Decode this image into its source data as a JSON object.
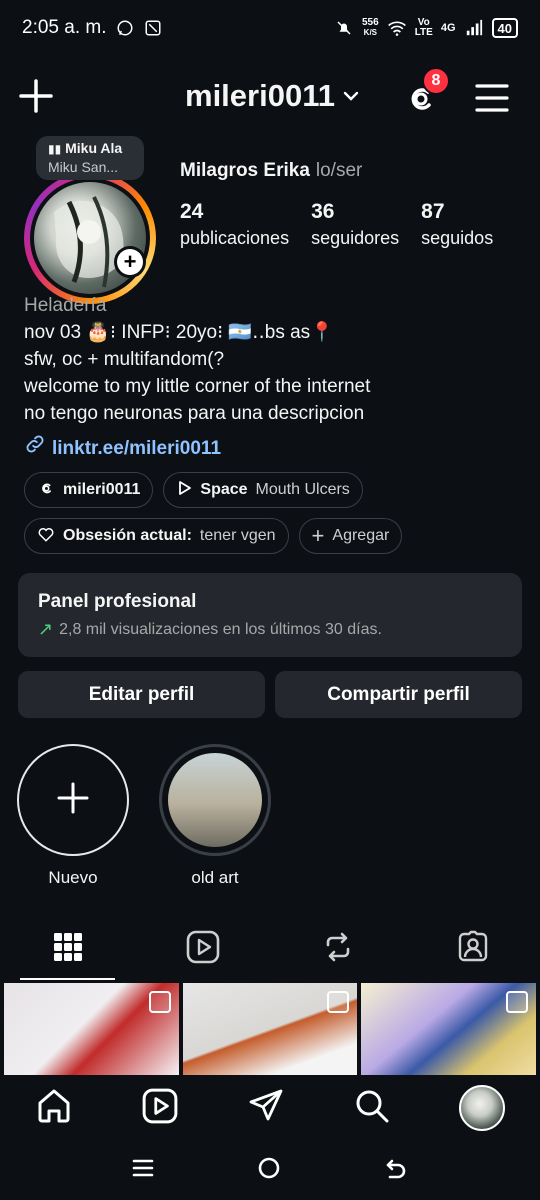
{
  "status_bar": {
    "time": "2:05 a. m.",
    "net_speed": "556",
    "net_unit": "K/S",
    "volte_top": "Vo",
    "volte_bottom": "LTE",
    "network": "4G",
    "battery": "40"
  },
  "header": {
    "username": "mileri0011",
    "threads_badge": "8"
  },
  "profile": {
    "music_title": "Miku Ala",
    "music_artist": "Miku San...",
    "name": "Milagros Erika",
    "pronouns": "lo/ser",
    "stats": [
      {
        "value": "24",
        "label": "publicaciones"
      },
      {
        "value": "36",
        "label": "seguidores"
      },
      {
        "value": "87",
        "label": "seguidos"
      }
    ],
    "category": "Heladería",
    "bio_lines": [
      "nov 03 🎂⁝ INFP⁝ 20yo⁝ 🇦🇷‥bs as📍",
      "sfw, oc + multifandom(?",
      "welcome to my little corner of the internet",
      "no tengo neuronas para una descripcion"
    ],
    "link": "linktr.ee/mileri0011"
  },
  "chips": {
    "threads": "mileri0011",
    "music_bold": "Space",
    "music_rest": "Mouth Ulcers",
    "obsession_bold": "Obsesión actual:",
    "obsession_rest": "tener vgen",
    "add": "Agregar"
  },
  "panel": {
    "title": "Panel profesional",
    "subtitle": "2,8 mil visualizaciones en los últimos 30 días."
  },
  "buttons": {
    "edit": "Editar perfil",
    "share": "Compartir perfil"
  },
  "highlights": [
    {
      "label": "Nuevo"
    },
    {
      "label": "old art"
    }
  ],
  "tabs": [
    "grid-icon",
    "reels-icon",
    "reposts-icon",
    "tagged-icon"
  ],
  "colors": {
    "background": "#0c0f14",
    "card": "#24272e",
    "badge": "#ff3040",
    "link": "#8ec3ff",
    "trend": "#4dd07a"
  }
}
